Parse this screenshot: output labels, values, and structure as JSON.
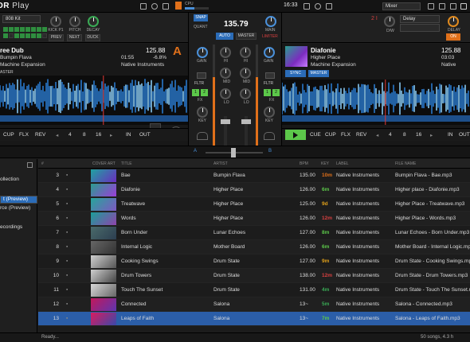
{
  "topbar": {
    "logo_prefix": "OR",
    "logo_suffix": "Play",
    "cpu_label": "CPU",
    "clock": "16:33",
    "mixer_mode": "Mixer"
  },
  "fx_left": {
    "preset": "808 Kit",
    "knobs": [
      "KICK P1",
      "PITCH",
      "DECAY"
    ],
    "buttons": [
      "PREV",
      "NEXT",
      "DUCK"
    ]
  },
  "fx_right": {
    "unit": "2 I",
    "preset": "Delay",
    "preset2": "Delay",
    "knob1": "D/W",
    "knob2": "DELAY",
    "on": "ON"
  },
  "master": {
    "snap": "SNAP",
    "quant": "QUANT",
    "bpm": "135.79",
    "auto": "AUTO",
    "master": "MASTER",
    "main": "MAIN",
    "limiter": "LIMITER"
  },
  "deck_a": {
    "title": "ree Dub",
    "artist": "Bumpin Flava",
    "label": "Machine Expansion",
    "bpm": "125.88",
    "time": "01:55",
    "tempo": "-6.8%",
    "label2": "Native Instruments",
    "letter": "A",
    "master_tag": "ASTER",
    "loop_values": [
      "4",
      "8",
      "16"
    ],
    "buttons": [
      "CUP",
      "FLX",
      "REV",
      "IN",
      "OUT"
    ]
  },
  "deck_b": {
    "title": "Diafonie",
    "artist": "Higher Place",
    "label": "Machine Expansion",
    "bpm": "125.88",
    "time": "03:03",
    "label2": "Native",
    "sync": "SYNC",
    "master": "MASTER",
    "loop_values": [
      "4",
      "8",
      "16"
    ],
    "buttons": [
      "CUE",
      "CUP",
      "FLX",
      "REV",
      "IN",
      "OUT"
    ]
  },
  "mixer": {
    "gain": "GAIN",
    "hi": "HI",
    "mid": "MID",
    "lo": "LO",
    "fltr": "FLTR",
    "fx": "FX",
    "key": "KEY",
    "fx1": "1",
    "fx2": "2",
    "xfade_a": "A",
    "xfade_b": "B"
  },
  "sidebar": {
    "items": [
      "ollection",
      "",
      "t (Preview)",
      "rce (Preview)",
      "",
      "ecordings"
    ],
    "selected_index": 2
  },
  "table": {
    "headers": [
      "#",
      "COVER ART",
      "TITLE",
      "ARTIST",
      "BPM",
      "KEY",
      "LABEL",
      "FILE NAME"
    ],
    "rows": [
      {
        "num": "3",
        "title": "Bae",
        "artist": "Bumpin Flava",
        "bpm": "135.00",
        "key": "10m",
        "key_color": "#e0701a",
        "label": "Native Instruments",
        "file": "Bumpin Flava - Bae.mp3"
      },
      {
        "num": "4",
        "title": "Diafonie",
        "artist": "Higher Place",
        "bpm": "126.00",
        "key": "6m",
        "key_color": "#5cc84a",
        "label": "Native Instruments",
        "file": "Higher place - Diafonie.mp3"
      },
      {
        "num": "5",
        "title": "Treatwave",
        "artist": "Higher Place",
        "bpm": "125.00",
        "key": "9d",
        "key_color": "#e0a01a",
        "label": "Native Instruments",
        "file": "Higher Place - Treatwave.mp3"
      },
      {
        "num": "6",
        "title": "Words",
        "artist": "Higher Place",
        "bpm": "126.00",
        "key": "12m",
        "key_color": "#d94040",
        "label": "Native Instruments",
        "file": "Higher Place - Words.mp3"
      },
      {
        "num": "7",
        "title": "Born Under",
        "artist": "Lunar Echoes",
        "bpm": "127.00",
        "key": "8m",
        "key_color": "#5cc84a",
        "label": "Native Instruments",
        "file": "Lunar Echoes - Born Under.mp3"
      },
      {
        "num": "8",
        "title": "Internal Logic",
        "artist": "Mother Board",
        "bpm": "126.00",
        "key": "6m",
        "key_color": "#5cc84a",
        "label": "Native Instruments",
        "file": "Mother Board - Internal Logic.mp3"
      },
      {
        "num": "9",
        "title": "Cooking Swings",
        "artist": "Drum State",
        "bpm": "127.00",
        "key": "9m",
        "key_color": "#e0a01a",
        "label": "Native Instruments",
        "file": "Drum State - Cooking Swings.mp3"
      },
      {
        "num": "10",
        "title": "Drum Towers",
        "artist": "Drum State",
        "bpm": "138.00",
        "key": "12m",
        "key_color": "#d94040",
        "label": "Native Instruments",
        "file": "Drum State - Drum Towers.mp3"
      },
      {
        "num": "11",
        "title": "Touch The Sunset",
        "artist": "Drum State",
        "bpm": "131.00",
        "key": "4m",
        "key_color": "#3aaa55",
        "label": "Native Instruments",
        "file": "Drum State - Touch The Sunset.mp3"
      },
      {
        "num": "12",
        "title": "Connected",
        "artist": "Salona",
        "bpm": "13~",
        "key": "5m",
        "key_color": "#3aaa55",
        "label": "Native Instruments",
        "file": "Salona - Connected.mp3"
      },
      {
        "num": "13",
        "title": "Leaps of Faith",
        "artist": "Salona",
        "bpm": "13~",
        "key": "7m",
        "key_color": "#5cc84a",
        "label": "Native Instruments",
        "file": "Salona - Leaps of Faith.mp3"
      }
    ],
    "highlight_index": 10
  },
  "status": {
    "left": "Ready...",
    "right": "50 songs, 4.3 h"
  }
}
